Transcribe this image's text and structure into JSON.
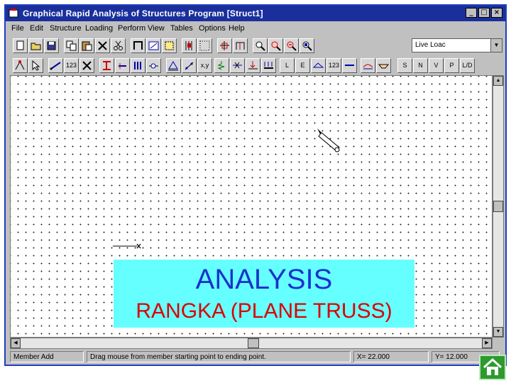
{
  "window": {
    "title": "Graphical Rapid Analysis of Structures Program [Struct1]",
    "controls": [
      "_",
      "□",
      "×"
    ]
  },
  "menu": [
    "File",
    "Edit",
    "Structure",
    "Loading",
    "Perform",
    "View",
    "Tables",
    "Options",
    "Help"
  ],
  "toolbar2": {
    "labels": [
      "123",
      "x,y",
      "L",
      "E",
      "123",
      "S",
      "N",
      "V",
      "P",
      "L/D"
    ]
  },
  "load_case": {
    "selected": "Live Loac"
  },
  "statusbar": {
    "mode": "Member Add",
    "hint": "Drag mouse from member starting point to ending point.",
    "x": "X= 22.000",
    "y": "Y= 12.000"
  },
  "overlay": {
    "title": "ANALYSIS",
    "subtitle": "RANGKA (PLANE TRUSS)"
  },
  "colors": {
    "titlebar": "#1a2f9c",
    "banner_bg": "#66ffff",
    "banner_title": "#1a33cc",
    "banner_subtitle": "#dd0000",
    "home_button": "#2e9a2e"
  }
}
